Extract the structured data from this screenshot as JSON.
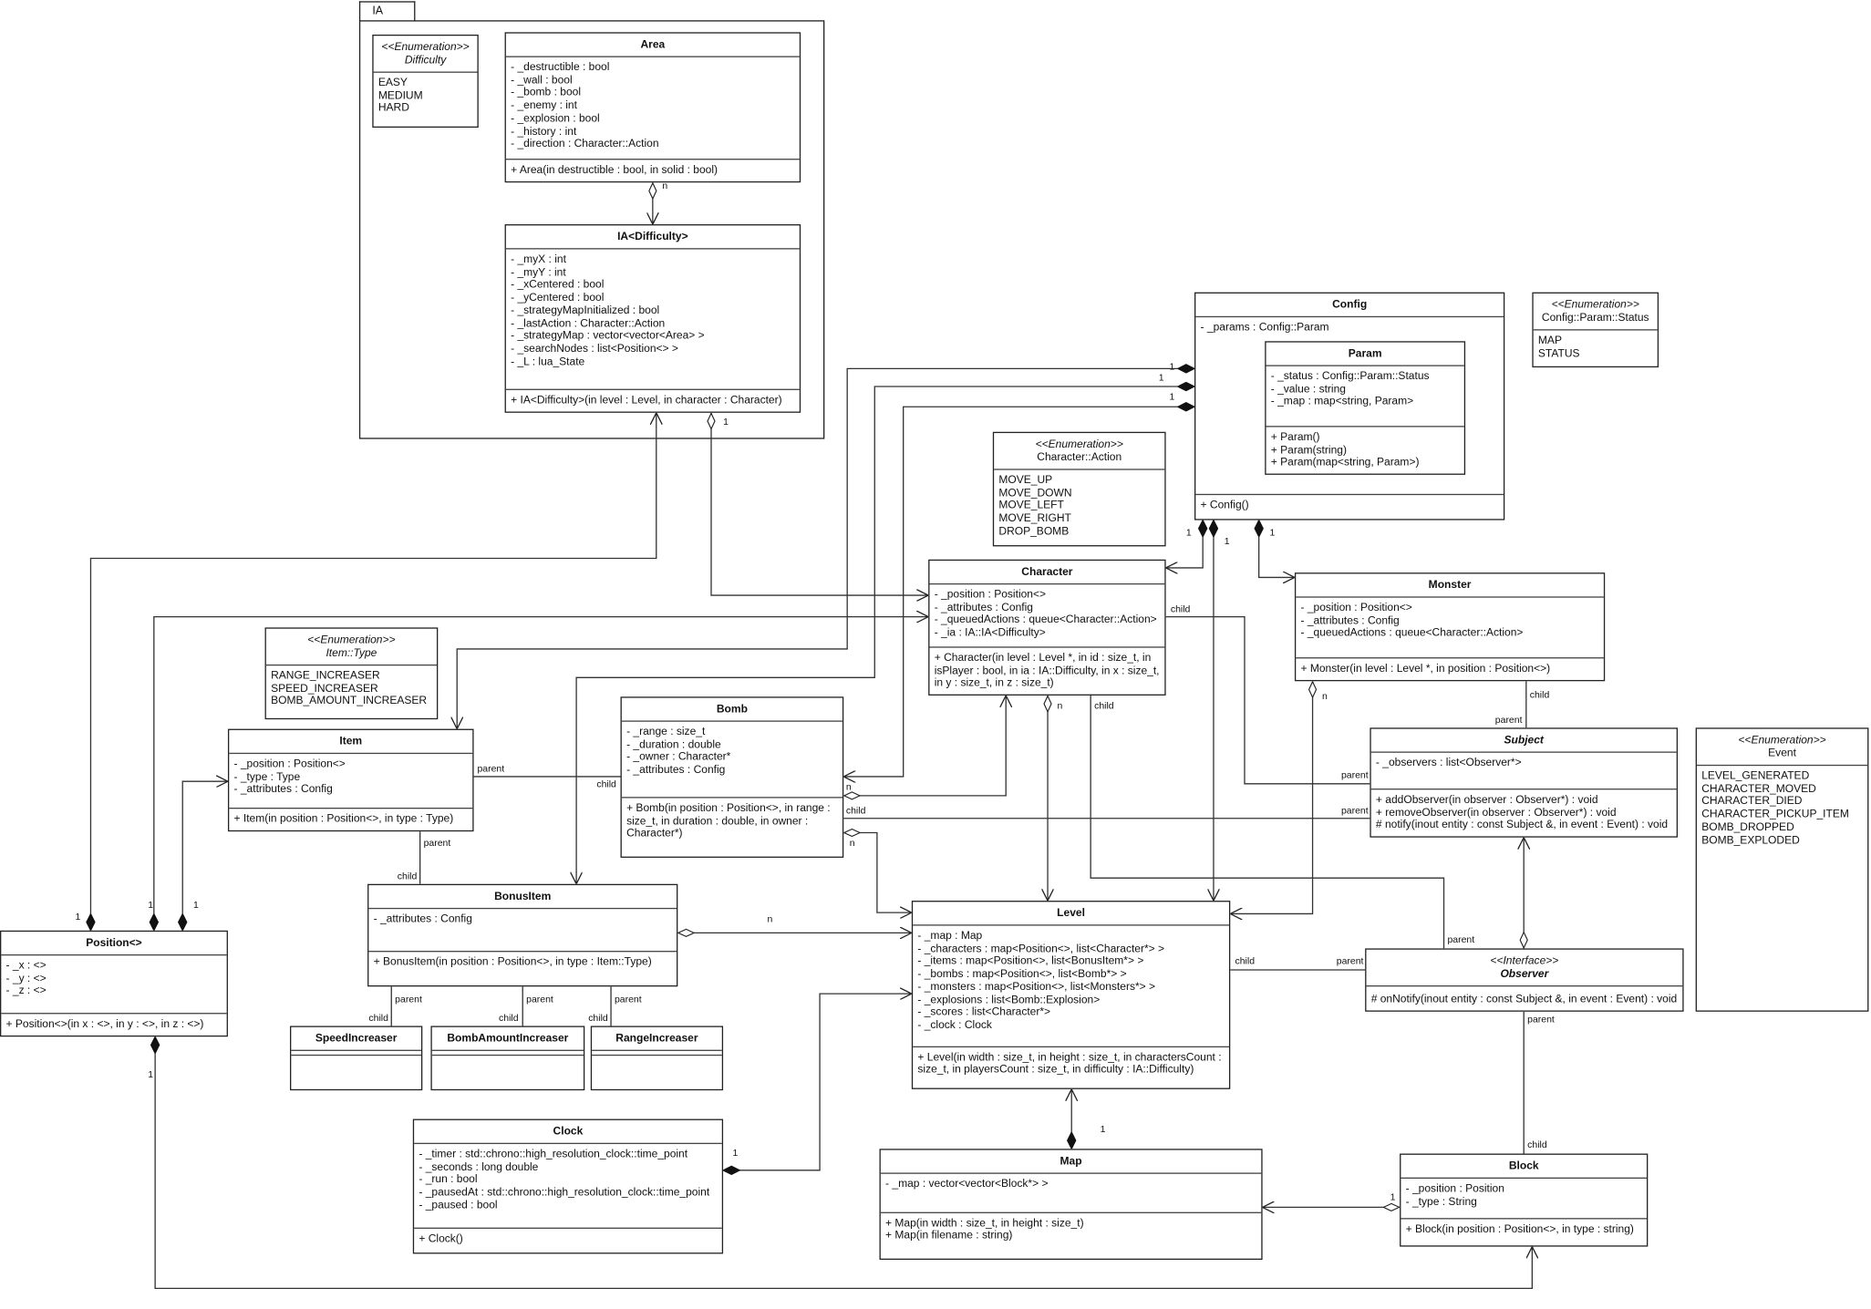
{
  "package": {
    "name": "IA"
  },
  "classes": {
    "difficulty": {
      "kind": "enum",
      "stereotype": "<<Enumeration>>",
      "name": "Difficulty",
      "italicName": true,
      "values": [
        "EASY",
        "MEDIUM",
        "HARD"
      ]
    },
    "area": {
      "kind": "class",
      "name": "Area",
      "attributes": [
        "- _destructible : bool",
        "- _wall : bool",
        "- _bomb : bool",
        "- _enemy : int",
        "- _explosion : bool",
        "- _history : int",
        "- _direction : Character::Action"
      ],
      "operations": [
        "+ Area(in destructible : bool, in solid : bool)"
      ]
    },
    "ia": {
      "kind": "class",
      "name": "IA<Difficulty>",
      "attributes": [
        "- _myX : int",
        "- _myY : int",
        "- _xCentered : bool",
        "- _yCentered : bool",
        "- _strategyMapInitialized : bool",
        "- _lastAction : Character::Action",
        "- _strategyMap : vector<vector<Area> >",
        "- _searchNodes : list<Position<> >",
        "- _L : lua_State"
      ],
      "operations": [
        "+ IA<Difficulty>(in level : Level, in character : Character)"
      ]
    },
    "config": {
      "kind": "class",
      "name": "Config",
      "attributes": [
        "- _params : Config::Param"
      ],
      "operations": [
        "+ Config()"
      ]
    },
    "param": {
      "kind": "class",
      "name": "Param",
      "attributes": [
        "- _status : Config::Param::Status",
        "- _value : string",
        "- _map : map<string, Param>"
      ],
      "operations": [
        "+ Param()",
        "+ Param(string)",
        "+ Param(map<string, Param>)"
      ]
    },
    "status": {
      "kind": "enum",
      "stereotype": "<<Enumeration>>",
      "name": "Config::Param::Status",
      "values": [
        "MAP",
        "STATUS"
      ]
    },
    "action": {
      "kind": "enum",
      "stereotype": "<<Enumeration>>",
      "name": "Character::Action",
      "values": [
        "MOVE_UP",
        "MOVE_DOWN",
        "MOVE_LEFT",
        "MOVE_RIGHT",
        "DROP_BOMB"
      ]
    },
    "character": {
      "kind": "class",
      "name": "Character",
      "attributes": [
        "- _position : Position<>",
        "- _attributes : Config",
        "- _queuedActions : queue<Character::Action>",
        "- _ia : IA::IA<Difficulty>"
      ],
      "operations": [
        "+ Character(in level : Level *, in id : size_t, in isPlayer : bool, in ia : IA::Difficulty, in x : size_t, in y : size_t, in z : size_t)"
      ]
    },
    "monster": {
      "kind": "class",
      "name": "Monster",
      "attributes": [
        "- _position : Position<>",
        "- _attributes : Config",
        "- _queuedActions : queue<Character::Action>"
      ],
      "operations": [
        "+ Monster(in level : Level *, in position : Position<>)"
      ]
    },
    "itemtype": {
      "kind": "enum",
      "stereotype": "<<Enumeration>>",
      "name": "Item::Type",
      "italicName": true,
      "values": [
        "RANGE_INCREASER",
        "SPEED_INCREASER",
        "BOMB_AMOUNT_INCREASER"
      ]
    },
    "item": {
      "kind": "class",
      "name": "Item",
      "attributes": [
        "- _position : Position<>",
        "- _type : Type",
        "- _attributes : Config"
      ],
      "operations": [
        "+ Item(in position : Position<>, in type : Type)"
      ]
    },
    "bomb": {
      "kind": "class",
      "name": "Bomb",
      "attributes": [
        "- _range : size_t",
        "- _duration : double",
        "- _owner : Character*",
        "- _attributes : Config"
      ],
      "operations": [
        "+ Bomb(in position : Position<>, in range : size_t, in duration : double, in owner : Character*)"
      ]
    },
    "subject": {
      "kind": "class",
      "name": "Subject",
      "italicName": true,
      "attributes": [
        "- _observers : list<Observer*>"
      ],
      "operations": [
        "+ addObserver(in observer : Observer*) : void",
        "+ removeObserver(in observer : Observer*) : void",
        "# notify(inout entity : const Subject &, in event : Event) : void"
      ]
    },
    "event": {
      "kind": "enum",
      "stereotype": "<<Enumeration>>",
      "name": "Event",
      "values": [
        "LEVEL_GENERATED",
        "CHARACTER_MOVED",
        "CHARACTER_DIED",
        "CHARACTER_PICKUP_ITEM",
        "BOMB_DROPPED",
        "BOMB_EXPLODED"
      ]
    },
    "bonusitem": {
      "kind": "class",
      "name": "BonusItem",
      "attributes": [
        "- _attributes : Config"
      ],
      "operations": [
        "+ BonusItem(in position : Position<>, in type : Item::Type)"
      ]
    },
    "position": {
      "kind": "class",
      "name": "Position<>",
      "attributes": [
        "- _x : <>",
        "- _y : <>",
        "- _z : <>"
      ],
      "operations": [
        "+ Position<>(in x : <>, in y : <>, in z : <>)"
      ]
    },
    "level": {
      "kind": "class",
      "name": "Level",
      "attributes": [
        "- _map : Map",
        "- _characters : map<Position<>, list<Character*> >",
        "- _items : map<Position<>, list<BonusItem*> >",
        "- _bombs : map<Position<>, list<Bomb*> >",
        "- _monsters : map<Position<>, list<Monsters*> >",
        "- _explosions : list<Bomb::Explosion>",
        "- _scores : list<Character*>",
        "- _clock : Clock"
      ],
      "operations": [
        "+ Level(in width : size_t, in height : size_t, in charactersCount : size_t, in playersCount : size_t, in difficulty : IA::Difficulty)"
      ]
    },
    "observer": {
      "kind": "interface",
      "stereotype": "<<Interface>>",
      "name": "Observer",
      "italicName": true,
      "attributes": [],
      "operations": [
        "# onNotify(inout entity : const Subject &, in event : Event) : void"
      ]
    },
    "speed": {
      "kind": "empty",
      "name": "SpeedIncreaser"
    },
    "bombamount": {
      "kind": "empty",
      "name": "BombAmountIncreaser"
    },
    "range": {
      "kind": "empty",
      "name": "RangeIncreaser"
    },
    "clock": {
      "kind": "class",
      "name": "Clock",
      "attributes": [
        "- _timer : std::chrono::high_resolution_clock::time_point",
        "- _seconds : long double",
        "- _run : bool",
        "- _pausedAt : std::chrono::high_resolution_clock::time_point",
        "- _paused : bool"
      ],
      "operations": [
        "+ Clock()"
      ]
    },
    "map": {
      "kind": "class",
      "name": "Map",
      "attributes": [
        "- _map : vector<vector<Block*> >"
      ],
      "operations": [
        "+ Map(in width : size_t, in height : size_t)",
        "+ Map(in filename : string)"
      ]
    },
    "block": {
      "kind": "class",
      "name": "Block",
      "attributes": [
        "- _position : Position",
        "- _type : String"
      ],
      "operations": [
        "+ Block(in position : Position<>, in type : string)"
      ]
    }
  },
  "relations": [
    {
      "from": "area",
      "to": "ia",
      "type": "aggregation",
      "labels": [
        "n"
      ]
    },
    {
      "from": "position",
      "to": "ia",
      "type": "composition",
      "labels": [
        "1"
      ]
    },
    {
      "from": "ia",
      "to": "character",
      "type": "aggregation",
      "labels": [
        "1"
      ]
    },
    {
      "from": "config",
      "to": "item",
      "type": "composition",
      "labels": [
        "1"
      ]
    },
    {
      "from": "config",
      "to": "bonusitem",
      "type": "composition",
      "labels": [
        "1"
      ]
    },
    {
      "from": "config",
      "to": "bomb",
      "type": "composition",
      "labels": [
        "1"
      ]
    },
    {
      "from": "config",
      "to": "character",
      "type": "composition",
      "labels": [
        "1"
      ]
    },
    {
      "from": "config",
      "to": "level",
      "type": "composition",
      "labels": [
        "1"
      ]
    },
    {
      "from": "config",
      "to": "monster",
      "type": "composition",
      "labels": [
        "1"
      ]
    },
    {
      "from": "position",
      "to": "character",
      "type": "composition",
      "labels": [
        "1"
      ]
    },
    {
      "from": "position",
      "to": "item",
      "type": "composition",
      "labels": [
        "1"
      ]
    },
    {
      "from": "item",
      "to": "bomb",
      "type": "generalization",
      "labels": [
        "parent",
        "child"
      ]
    },
    {
      "from": "item",
      "to": "bonusitem",
      "type": "generalization",
      "labels": [
        "parent",
        "child"
      ]
    },
    {
      "from": "bonusitem",
      "to": "speed",
      "type": "generalization",
      "labels": [
        "parent",
        "child"
      ]
    },
    {
      "from": "bonusitem",
      "to": "bombamount",
      "type": "generalization",
      "labels": [
        "parent",
        "child"
      ]
    },
    {
      "from": "bonusitem",
      "to": "range",
      "type": "generalization",
      "labels": [
        "parent",
        "child"
      ]
    },
    {
      "from": "bomb",
      "to": "character",
      "type": "aggregation",
      "labels": [
        "n"
      ]
    },
    {
      "from": "bomb",
      "to": "level",
      "type": "aggregation",
      "labels": [
        "n"
      ]
    },
    {
      "from": "subject",
      "to": "bomb",
      "type": "generalization",
      "labels": [
        "child",
        "parent"
      ]
    },
    {
      "from": "subject",
      "to": "character",
      "type": "generalization",
      "labels": [
        "child",
        "parent"
      ]
    },
    {
      "from": "character",
      "to": "level",
      "type": "aggregation",
      "labels": [
        "n"
      ]
    },
    {
      "from": "observer",
      "to": "character",
      "type": "generalization",
      "labels": [
        "child",
        "parent"
      ]
    },
    {
      "from": "monster",
      "to": "level",
      "type": "aggregation",
      "labels": [
        "n"
      ]
    },
    {
      "from": "subject",
      "to": "monster",
      "type": "generalization",
      "labels": [
        "child",
        "parent"
      ]
    },
    {
      "from": "bonusitem",
      "to": "level",
      "type": "aggregation",
      "labels": [
        "n"
      ]
    },
    {
      "from": "clock",
      "to": "level",
      "type": "composition",
      "labels": [
        "1"
      ]
    },
    {
      "from": "observer",
      "to": "level",
      "type": "generalization",
      "labels": [
        "child",
        "parent"
      ]
    },
    {
      "from": "observer",
      "to": "subject",
      "type": "aggregation",
      "labels": []
    },
    {
      "from": "observer",
      "to": "block",
      "type": "generalization",
      "labels": [
        "parent",
        "child"
      ]
    },
    {
      "from": "map",
      "to": "level",
      "type": "composition",
      "labels": [
        "1"
      ]
    },
    {
      "from": "block",
      "to": "map",
      "type": "aggregation",
      "labels": [
        "1"
      ]
    },
    {
      "from": "position",
      "to": "block",
      "type": "composition",
      "labels": [
        "1"
      ]
    }
  ]
}
